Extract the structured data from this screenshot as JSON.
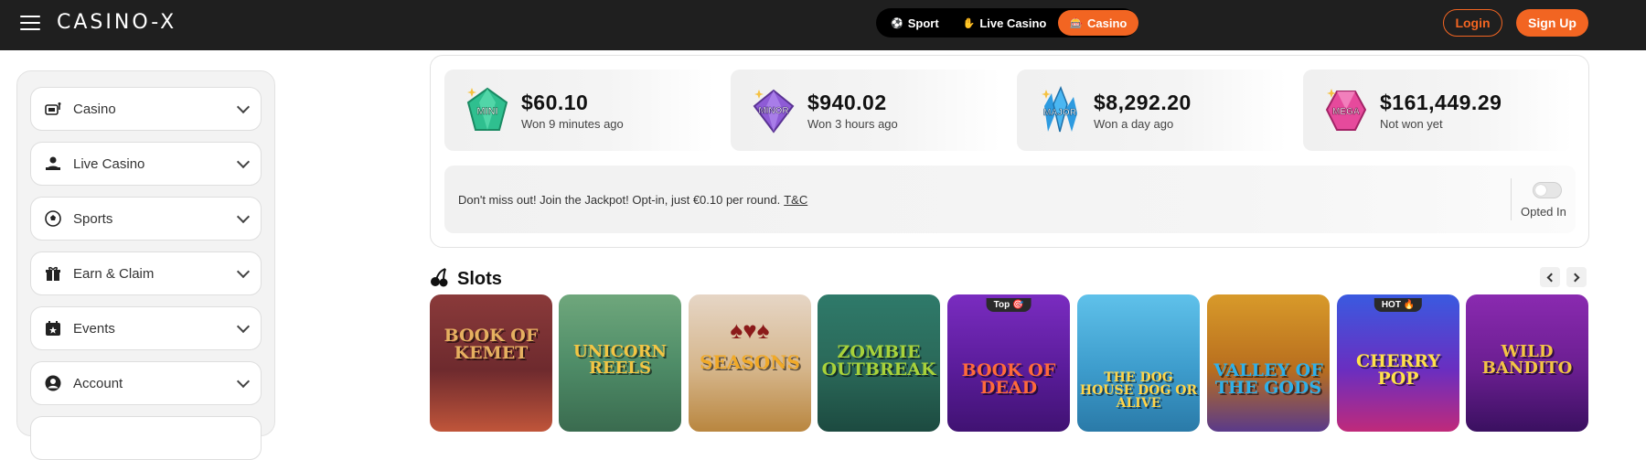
{
  "header": {
    "logo": "CASINO-X",
    "switcher": [
      {
        "label": "Sport",
        "icon": "soccer-ball-icon"
      },
      {
        "label": "Live Casino",
        "icon": "chip-hand-icon"
      },
      {
        "label": "Casino",
        "icon": "slot-machine-icon",
        "active": true
      }
    ],
    "login": "Login",
    "signup": "Sign Up",
    "accent": "#f26522"
  },
  "sidebar": {
    "items": [
      {
        "label": "Casino",
        "icon": "slot-machine-icon"
      },
      {
        "label": "Live Casino",
        "icon": "live-dealer-icon"
      },
      {
        "label": "Sports",
        "icon": "soccer-ball-icon"
      },
      {
        "label": "Earn & Claim",
        "icon": "gift-icon"
      },
      {
        "label": "Events",
        "icon": "calendar-star-icon"
      },
      {
        "label": "Account",
        "icon": "user-icon"
      }
    ]
  },
  "jackpot": {
    "cards": [
      {
        "gem": "MINI",
        "amount": "$60.10",
        "status": "Won 9 minutes ago",
        "color": "#2fbf8f"
      },
      {
        "gem": "MINOR",
        "amount": "$940.02",
        "status": "Won 3 hours ago",
        "color": "#8e5bd6"
      },
      {
        "gem": "MAJOR",
        "amount": "$8,292.20",
        "status": "Won a day ago",
        "color": "#2e9be0"
      },
      {
        "gem": "MEGA",
        "amount": "$161,449.29",
        "status": "Not won yet",
        "color": "#e64a9c"
      }
    ],
    "optin_text": "Don't miss out! Join the Jackpot! Opt-in, just €0.10 per round.",
    "optin_link": "T&C",
    "optin_label": "Opted In",
    "opted_in": false
  },
  "slots": {
    "title": "Slots",
    "games": [
      {
        "title": "BOOK OF KEMET",
        "badge": ""
      },
      {
        "title": "UNICORN REELS",
        "badge": ""
      },
      {
        "title": "SEASONS",
        "badge": ""
      },
      {
        "title": "ZOMBIE OUTBREAK",
        "badge": ""
      },
      {
        "title": "BOOK OF DEAD",
        "badge": "Top 🎯"
      },
      {
        "title": "THE DOG HOUSE DOG OR ALIVE",
        "badge": ""
      },
      {
        "title": "VALLEY OF THE GODS",
        "badge": ""
      },
      {
        "title": "CHERRY POP",
        "badge": "HOT 🔥"
      },
      {
        "title": "WILD BANDITO",
        "badge": ""
      }
    ]
  }
}
